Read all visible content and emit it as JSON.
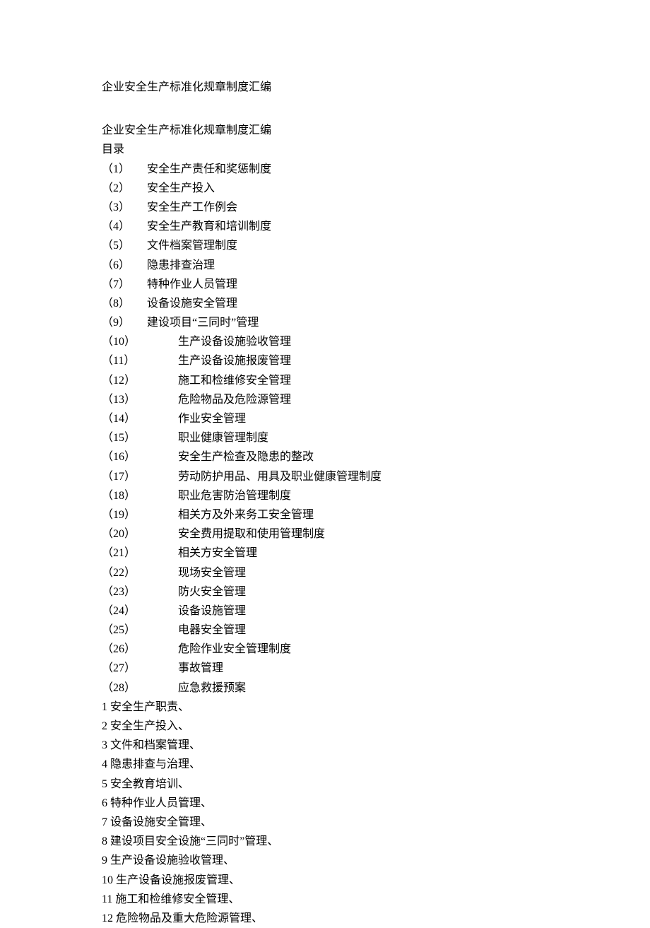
{
  "title": "企业安全生产标准化规章制度汇编",
  "subtitle": "企业安全生产标准化规章制度汇编",
  "toc_label": "目录",
  "toc": [
    {
      "num": "（1）",
      "text": "安全生产责任和奖惩制度",
      "wide": false
    },
    {
      "num": "（2）",
      "text": "安全生产投入",
      "wide": false
    },
    {
      "num": "（3）",
      "text": "安全生产工作例会",
      "wide": false
    },
    {
      "num": "（4）",
      "text": "安全生产教育和培训制度",
      "wide": false
    },
    {
      "num": "（5）",
      "text": "文件档案管理制度",
      "wide": false
    },
    {
      "num": "（6）",
      "text": "隐患排查治理",
      "wide": false
    },
    {
      "num": "（7）",
      "text": "特种作业人员管理",
      "wide": false
    },
    {
      "num": "（8）",
      "text": "设备设施安全管理",
      "wide": false
    },
    {
      "num": "（9）",
      "text": "建设项目“三同时”管理",
      "wide": false
    },
    {
      "num": "（10）",
      "text": "生产设备设施验收管理",
      "wide": true
    },
    {
      "num": "（11）",
      "text": "生产设备设施报废管理",
      "wide": true
    },
    {
      "num": "（12）",
      "text": "施工和检维修安全管理",
      "wide": true
    },
    {
      "num": "（13）",
      "text": "危险物品及危险源管理",
      "wide": true
    },
    {
      "num": "（14）",
      "text": "作业安全管理",
      "wide": true
    },
    {
      "num": "（15）",
      "text": "职业健康管理制度",
      "wide": true
    },
    {
      "num": "（16）",
      "text": "安全生产检查及隐患的整改",
      "wide": true
    },
    {
      "num": "（17）",
      "text": "劳动防护用品、用具及职业健康管理制度",
      "wide": true
    },
    {
      "num": "（18）",
      "text": "职业危害防治管理制度",
      "wide": true
    },
    {
      "num": "（19）",
      "text": "相关方及外来务工安全管理",
      "wide": true
    },
    {
      "num": "（20）",
      "text": "安全费用提取和使用管理制度",
      "wide": true
    },
    {
      "num": "（21）",
      "text": "相关方安全管理",
      "wide": true
    },
    {
      "num": "（22）",
      "text": "现场安全管理",
      "wide": true
    },
    {
      "num": "（23）",
      "text": "防火安全管理",
      "wide": true
    },
    {
      "num": "（24）",
      "text": "设备设施管理",
      "wide": true
    },
    {
      "num": "（25）",
      "text": "电器安全管理",
      "wide": true
    },
    {
      "num": "（26）",
      "text": "危险作业安全管理制度",
      "wide": true
    },
    {
      "num": "（27）",
      "text": "事故管理",
      "wide": true
    },
    {
      "num": "（28）",
      "text": "应急救援预案",
      "wide": true
    }
  ],
  "list": [
    "1 安全生产职责、",
    "2 安全生产投入、",
    "3 文件和档案管理、",
    "4 隐患排查与治理、",
    "5 安全教育培训、",
    "6 特种作业人员管理、",
    "7 设备设施安全管理、",
    "8 建设项目安全设施“三同时”管理、",
    "9 生产设备设施验收管理、",
    "10 生产设备设施报废管理、",
    "11 施工和检维修安全管理、",
    "12 危险物品及重大危险源管理、"
  ]
}
